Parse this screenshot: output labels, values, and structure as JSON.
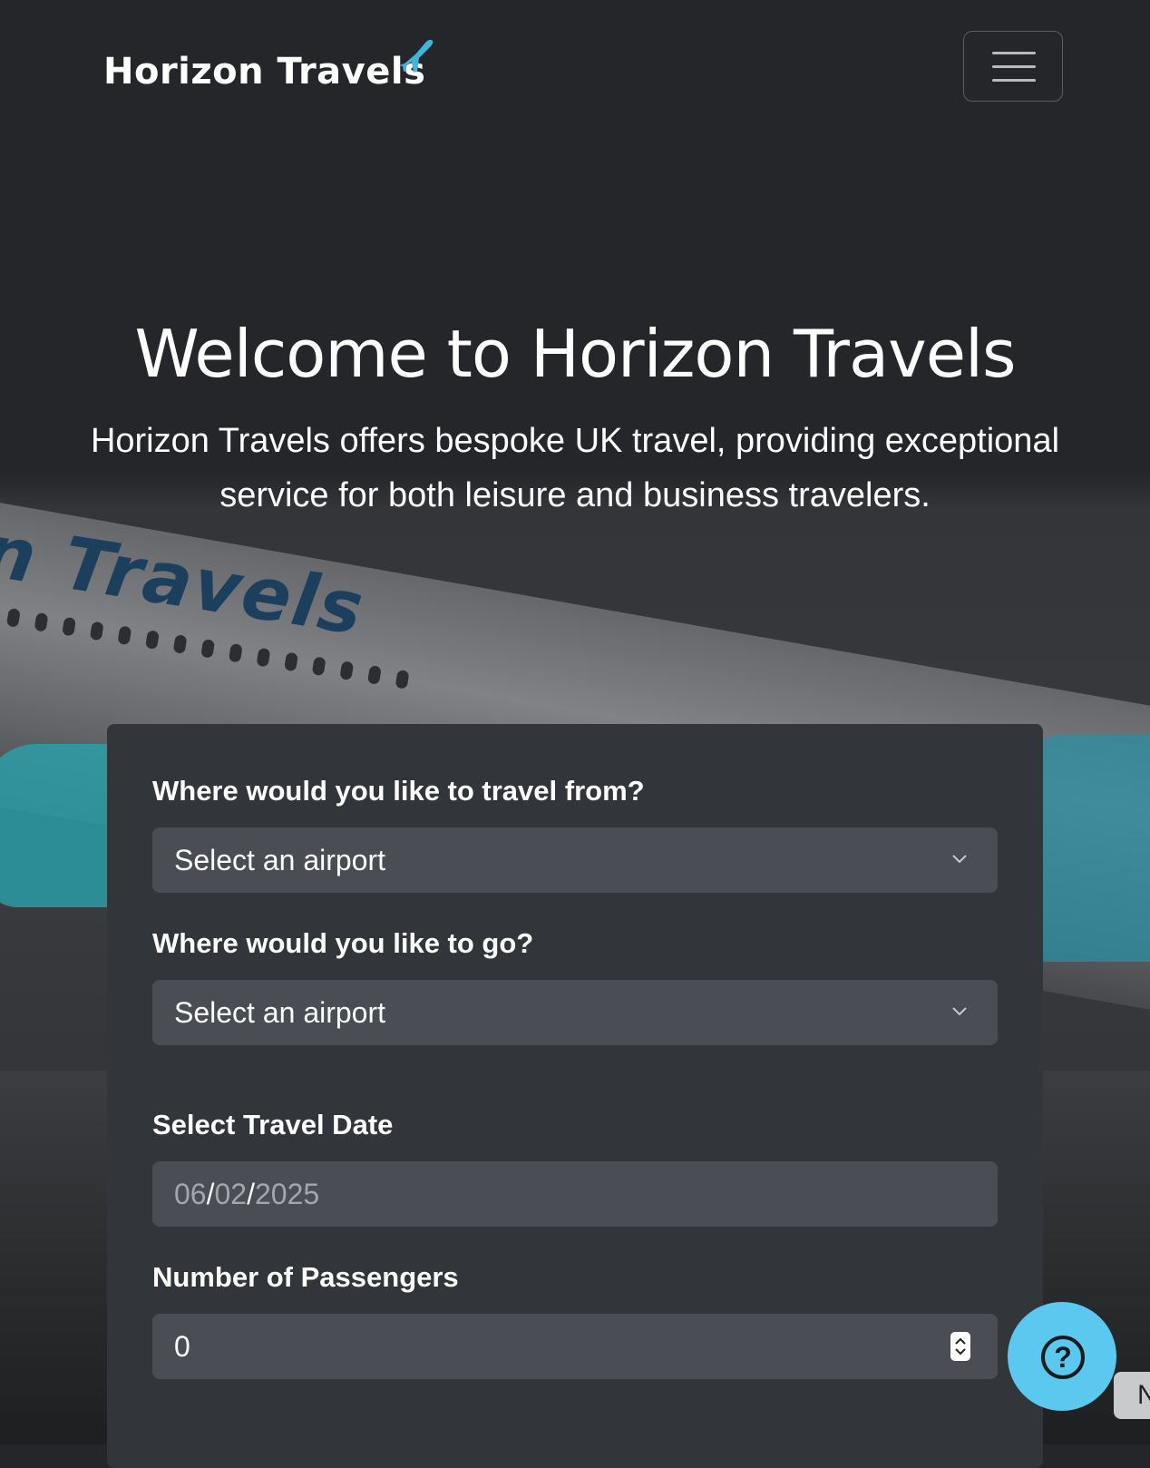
{
  "navbar": {
    "brand": "Horizon Travels",
    "brand_icon": "airplane-icon",
    "menu_icon": "hamburger-icon"
  },
  "hero": {
    "title": "Welcome to Horizon Travels",
    "subtitle": "Horizon Travels offers bespoke UK travel, providing exceptional service for both leisure and business travelers.",
    "background_text": "n Travels"
  },
  "form": {
    "from_label": "Where would you like to travel from?",
    "from_value": "Select an airport",
    "to_label": "Where would you like to go?",
    "to_value": "Select an airport",
    "date_label": "Select Travel Date",
    "date_day": "06",
    "date_month": "02",
    "date_year": "2025",
    "date_separator": "/",
    "passengers_label": "Number of Passengers",
    "passengers_value": "0"
  },
  "help": {
    "icon": "question-icon",
    "glyph": "?"
  },
  "side_tab": {
    "label": "N"
  },
  "colors": {
    "page_bg": "#25262a",
    "card_bg": "#32353a",
    "field_bg": "#4a4d54",
    "help_accent": "#5bc8ef",
    "brand_plane": "#3fb4dc"
  }
}
